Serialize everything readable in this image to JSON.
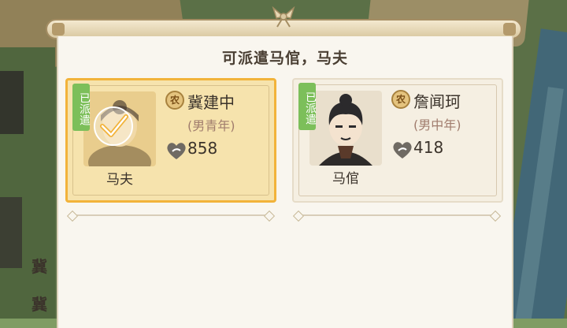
{
  "dialog": {
    "title": "可派遣马倌，马夫"
  },
  "cards": [
    {
      "status_tag": "已派遣",
      "role": "马夫",
      "type_badge": "农",
      "name": "冀建中",
      "desc": "(男青年)",
      "score": "858",
      "selected": true
    },
    {
      "status_tag": "已派遣",
      "role": "马倌",
      "type_badge": "农",
      "name": "詹闻珂",
      "desc": "(男中年)",
      "score": "418",
      "selected": false
    }
  ],
  "left_list": [
    "冀",
    "冀"
  ],
  "colors": {
    "selected_border": "#f2b33a",
    "tag_green": "#7cbf5a",
    "panel_bg": "#f9f6ef"
  }
}
